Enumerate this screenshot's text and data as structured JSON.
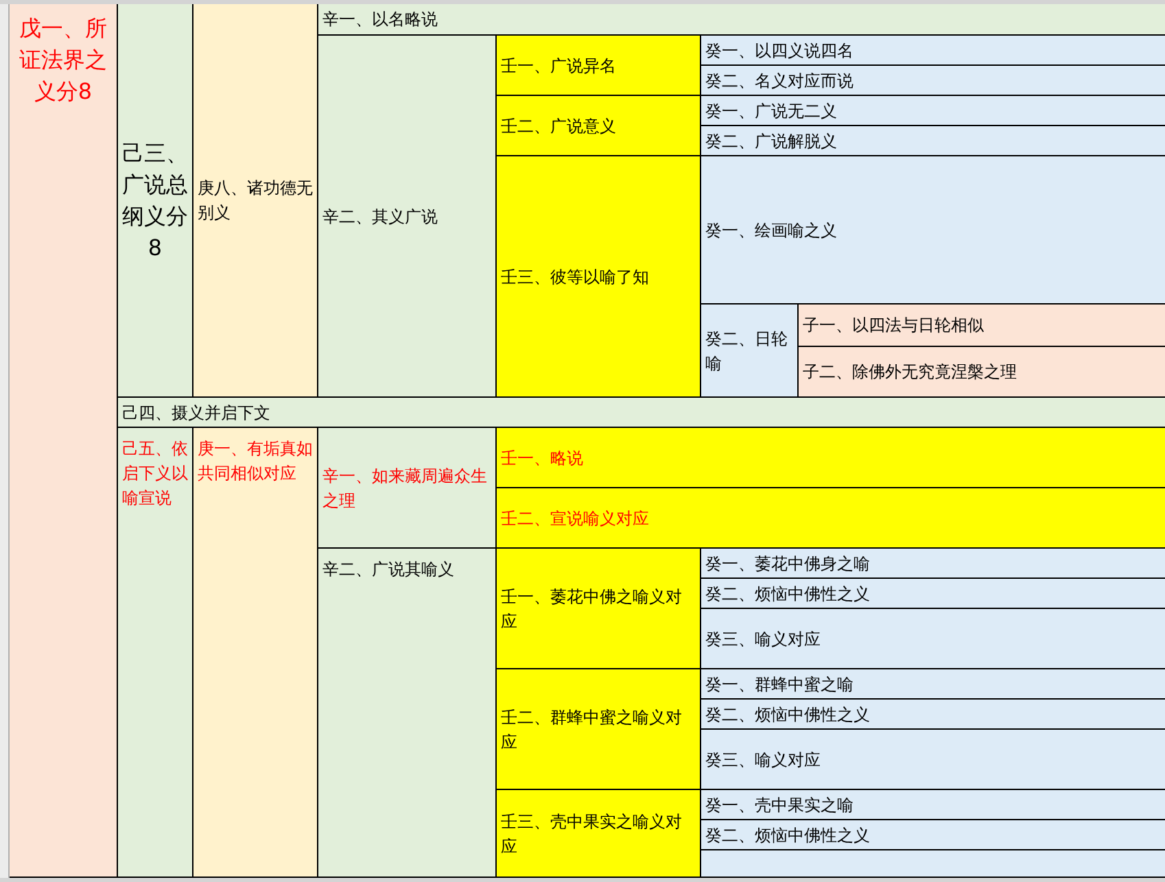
{
  "outline": [
    {
      "text": "戊一、所证法界之义分8",
      "color": "#fce4d6",
      "red": true,
      "children": [
        {
          "text": "己三、广说总纲义分8",
          "color": "#e2efda",
          "red": false,
          "children": [
            {
              "text": "庚八、诸功德无别义",
              "color": "#fff2cc",
              "red": false,
              "children": [
                {
                  "text": "辛一、以名略说",
                  "color": "#e2efda",
                  "red": false
                },
                {
                  "text": "辛二、其义广说",
                  "color": "#e2efda",
                  "red": false,
                  "children": [
                    {
                      "text": "壬一、广说异名",
                      "color": "#ffff00",
                      "red": false,
                      "children": [
                        {
                          "text": "癸一、以四义说四名",
                          "color": "#ddebf7",
                          "red": false
                        },
                        {
                          "text": "癸二、名义对应而说",
                          "color": "#ddebf7",
                          "red": false
                        }
                      ]
                    },
                    {
                      "text": "壬二、广说意义",
                      "color": "#ffff00",
                      "red": false,
                      "children": [
                        {
                          "text": "癸一、广说无二义",
                          "color": "#ddebf7",
                          "red": false
                        },
                        {
                          "text": "癸二、广说解脱义",
                          "color": "#ddebf7",
                          "red": false
                        }
                      ]
                    },
                    {
                      "text": "壬三、彼等以喻了知",
                      "color": "#ffff00",
                      "red": false,
                      "children": [
                        {
                          "text": "癸一、绘画喻之义",
                          "color": "#ddebf7",
                          "red": false
                        },
                        {
                          "text": "癸二、日轮喻",
                          "color": "#ddebf7",
                          "red": false,
                          "children": [
                            {
                              "text": "子一、以四法与日轮相似",
                              "color": "#fce4d6",
                              "red": false
                            },
                            {
                              "text": "子二、除佛外无究竟涅槃之理",
                              "color": "#fce4d6",
                              "red": false
                            }
                          ]
                        }
                      ]
                    }
                  ]
                }
              ]
            }
          ]
        },
        {
          "text": "己四、摄义并启下文",
          "color": "#e2efda",
          "red": false
        },
        {
          "text": "己五、依启下义以喻宣说",
          "color": "#e2efda",
          "red": true,
          "children": [
            {
              "text": "庚一、有垢真如共同相似对应",
              "color": "#fff2cc",
              "red": true,
              "children": [
                {
                  "text": "辛一、如来藏周遍众生之理",
                  "color": "#e2efda",
                  "red": true,
                  "children": [
                    {
                      "text": "壬一、略说",
                      "color": "#ffff00",
                      "red": true
                    },
                    {
                      "text": "壬二、宣说喻义对应",
                      "color": "#ffff00",
                      "red": true
                    }
                  ]
                },
                {
                  "text": "辛二、广说其喻义",
                  "color": "#e2efda",
                  "red": false,
                  "children": [
                    {
                      "text": "壬一、萎花中佛之喻义对应",
                      "color": "#ffff00",
                      "red": false,
                      "children": [
                        {
                          "text": "癸一、萎花中佛身之喻",
                          "color": "#ddebf7",
                          "red": false
                        },
                        {
                          "text": "癸二、烦恼中佛性之义",
                          "color": "#ddebf7",
                          "red": false
                        },
                        {
                          "text": "癸三、喻义对应",
                          "color": "#ddebf7",
                          "red": false
                        }
                      ]
                    },
                    {
                      "text": "壬二、群蜂中蜜之喻义对应",
                      "color": "#ffff00",
                      "red": false,
                      "children": [
                        {
                          "text": "癸一、群蜂中蜜之喻",
                          "color": "#ddebf7",
                          "red": false
                        },
                        {
                          "text": "癸二、烦恼中佛性之义",
                          "color": "#ddebf7",
                          "red": false
                        },
                        {
                          "text": "癸三、喻义对应",
                          "color": "#ddebf7",
                          "red": false
                        }
                      ]
                    },
                    {
                      "text": "壬三、壳中果实之喻义对应",
                      "color": "#ffff00",
                      "red": false,
                      "children": [
                        {
                          "text": "癸一、壳中果实之喻",
                          "color": "#ddebf7",
                          "red": false
                        },
                        {
                          "text": "癸二、烦恼中佛性之义",
                          "color": "#ddebf7",
                          "red": false
                        },
                        {
                          "color": "#ddebf7"
                        }
                      ]
                    }
                  ]
                }
              ]
            }
          ]
        }
      ]
    }
  ]
}
